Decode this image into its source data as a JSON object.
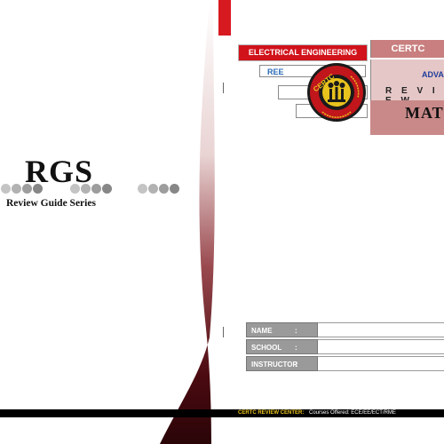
{
  "left_panel": {
    "title": "RGS",
    "subtitle": "Review Guide Series"
  },
  "header": {
    "department_banner": "ELECTRICAL ENGINEERING",
    "program_code": "REE",
    "brand": "CERTC",
    "course_partial": "ADVA",
    "review_label": "R E V I E W",
    "subject_partial": "MAT"
  },
  "logo": {
    "text": "CERTC",
    "ring_text": "ENGINEERING REVIEW CENTER"
  },
  "form": {
    "rows": [
      {
        "label": "NAME",
        "sep": ":"
      },
      {
        "label": "SCHOOL",
        "sep": ":"
      },
      {
        "label": "INSTRUCTOR",
        "sep": ":"
      }
    ]
  },
  "footer": {
    "center_name": "CERTC REVIEW CENTER:",
    "courses": "Courses Offered: ECE/EE/ECT/RME"
  },
  "colors": {
    "accent_red": "#d1121b",
    "maroon": "#5a0c10",
    "dot_gray": "#9a9a9a"
  }
}
